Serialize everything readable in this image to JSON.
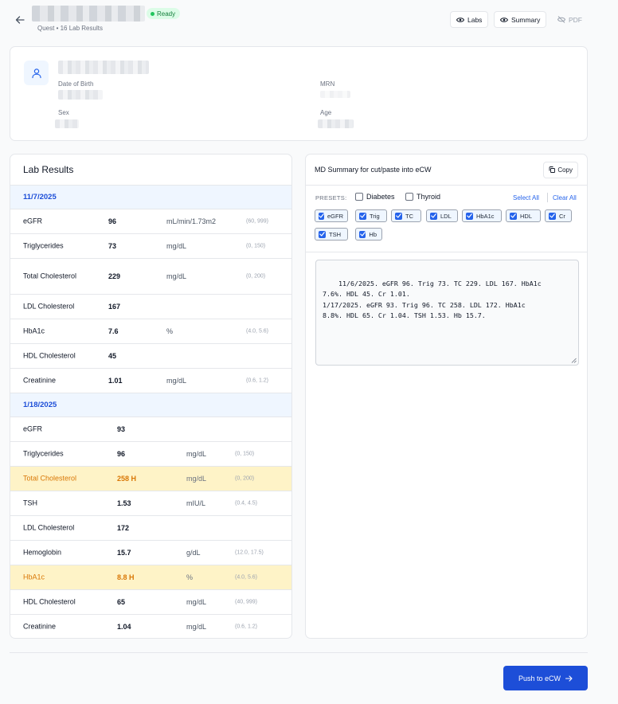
{
  "header": {
    "status": "Ready",
    "subtitle": "Quest • 16 Lab Results",
    "labs_label": "Labs",
    "summary_label": "Summary",
    "pdf_label": "PDF"
  },
  "patient": {
    "dob_label": "Date of Birth",
    "mrn_label": "MRN",
    "sex_label": "Sex",
    "age_label": "Age"
  },
  "lab_results": {
    "title": "Lab Results",
    "groups": [
      {
        "date": "11/7/2025",
        "rows": [
          {
            "name": "eGFR",
            "value": "96",
            "unit": "mL/min/1.73m2",
            "range": "(60, 999)",
            "flag": false
          },
          {
            "name": "Triglycerides",
            "value": "73",
            "unit": "mg/dL",
            "range": "(0, 150)",
            "flag": false
          },
          {
            "name": "Total Cholesterol",
            "value": "229",
            "unit": "mg/dL",
            "range": "(0, 200)",
            "flag": false
          },
          {
            "name": "LDL Cholesterol",
            "value": "167",
            "unit": "",
            "range": "",
            "flag": false
          },
          {
            "name": "HbA1c",
            "value": "7.6",
            "unit": "%",
            "range": "(4.0, 5.6)",
            "flag": false
          },
          {
            "name": "HDL Cholesterol",
            "value": "45",
            "unit": "",
            "range": "",
            "flag": false
          },
          {
            "name": "Creatinine",
            "value": "1.01",
            "unit": "mg/dL",
            "range": "(0.6, 1.2)",
            "flag": false
          }
        ]
      },
      {
        "date": "1/18/2025",
        "rows": [
          {
            "name": "eGFR",
            "value": "93",
            "unit": "",
            "range": "",
            "flag": false
          },
          {
            "name": "Triglycerides",
            "value": "96",
            "unit": "mg/dL",
            "range": "(0, 150)",
            "flag": false
          },
          {
            "name": "Total Cholesterol",
            "value": "258 H",
            "unit": "mg/dL",
            "range": "(0, 200)",
            "flag": true
          },
          {
            "name": "TSH",
            "value": "1.53",
            "unit": "mIU/L",
            "range": "(0.4, 4.5)",
            "flag": false
          },
          {
            "name": "LDL Cholesterol",
            "value": "172",
            "unit": "",
            "range": "",
            "flag": false
          },
          {
            "name": "Hemoglobin",
            "value": "15.7",
            "unit": "g/dL",
            "range": "(12.0, 17.5)",
            "flag": false
          },
          {
            "name": "HbA1c",
            "value": "8.8 H",
            "unit": "%",
            "range": "(4.0, 5.6)",
            "flag": true
          },
          {
            "name": "HDL Cholesterol",
            "value": "65",
            "unit": "mg/dL",
            "range": "(40, 999)",
            "flag": false
          },
          {
            "name": "Creatinine",
            "value": "1.04",
            "unit": "mg/dL",
            "range": "(0.6, 1.2)",
            "flag": false
          }
        ]
      }
    ]
  },
  "summary": {
    "title": "MD Summary for cut/paste into eCW",
    "copy_label": "Copy",
    "presets_label": "PRESETS:",
    "presets": [
      "Diabetes",
      "Thyroid"
    ],
    "select_all": "Select All",
    "clear_all": "Clear All",
    "chips": [
      "eGFR",
      "Trig",
      "TC",
      "LDL",
      "HbA1c",
      "HDL",
      "Cr",
      "TSH",
      "Hb"
    ],
    "text": "11/6/2025. eGFR 96. Trig 73. TC 229. LDL 167. HbA1c\n7.6%. HDL 45. Cr 1.01.\n1/17/2025. eGFR 93. Trig 96. TC 258. LDL 172. HbA1c\n8.8%. HDL 65. Cr 1.04. TSH 1.53. Hb 15.7."
  },
  "footer": {
    "push_label": "Push to eCW"
  },
  "colors": {
    "accent": "#1d4ed8",
    "flag_bg": "#fef3c7",
    "flag_text": "#d97706",
    "date_bg": "#eff6ff"
  }
}
